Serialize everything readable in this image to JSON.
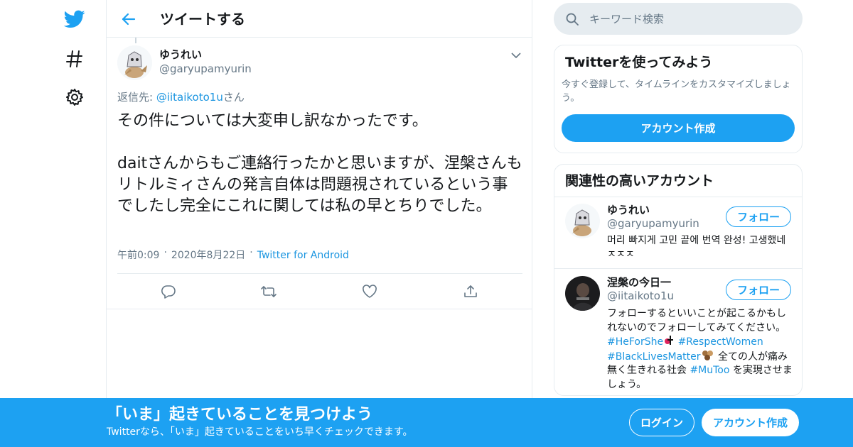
{
  "colors": {
    "accent": "#1da1f2",
    "link": "#1b95e0",
    "secondary_text": "#657786",
    "border": "#e6ecf0"
  },
  "nav": {
    "icons": [
      "twitter-bird-icon",
      "hashtag-icon",
      "gear-icon"
    ]
  },
  "header": {
    "title": "ツイートする",
    "back_icon": "arrow-left-icon"
  },
  "tweet": {
    "author_name": "ゆうれい",
    "author_handle": "@garyupamyurin",
    "reply_prefix": "返信先: ",
    "reply_target": "@iitaikoto1u",
    "reply_suffix": "さん",
    "text": "その件については大変申し訳なかったです。\n\ndaitさんからもご連絡行ったかと思いますが、涅槃さんもリトルミィさんの発言自体は問題視されているという事でしたし完全にこれに関しては私の早とちりでした。",
    "time": "午前0:09",
    "date": "2020年8月22日",
    "source": "Twitter for Android",
    "separator": "·",
    "actions": [
      "reply-icon",
      "retweet-icon",
      "like-icon",
      "share-icon"
    ]
  },
  "search": {
    "placeholder": "キーワード検索"
  },
  "signup_card": {
    "title": "Twitterを使ってみよう",
    "subtitle": "今すぐ登録して、タイムラインをカスタマイズしましょう。",
    "button": "アカウント作成"
  },
  "related": {
    "title": "関連性の高いアカウント",
    "follow_label": "フォロー",
    "accounts": [
      {
        "name": "ゆうれい",
        "handle": "@garyupamyurin",
        "bio": "머리 빠지게 고민 끝에 번역 완성! 고생했네 ㅈㅈㅈ"
      },
      {
        "name": "涅槃の今日一",
        "handle": "@iitaikoto1u",
        "bio_1": "フォローするといいことが起こるかもしれないのでフォローしてみてください。 ",
        "tag_1": "#HeForShe",
        "tag_2": "#RespectWomen",
        "tag_3": "#BlackLivesMatter",
        "bio_2": " 全ての人が痛み無く生きれる社会 ",
        "tag_4": "#MuToo",
        "bio_3": " を実現させましょう。"
      }
    ]
  },
  "bottom_bar": {
    "title": "「いま」起きていることを見つけよう",
    "subtitle": "Twitterなら、「いま」起きていることをいち早くチェックできます。",
    "login": "ログイン",
    "signup": "アカウント作成"
  }
}
